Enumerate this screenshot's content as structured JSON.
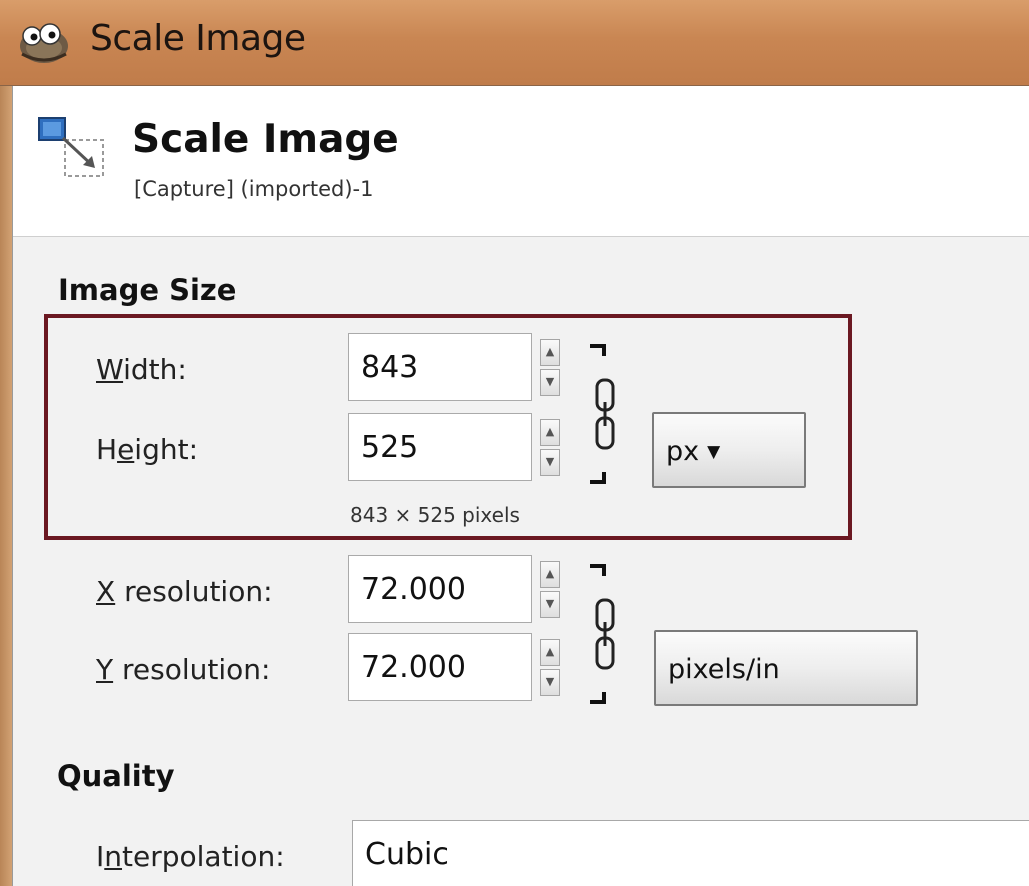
{
  "window": {
    "title": "Scale Image",
    "icon": "gimp-icon"
  },
  "header": {
    "title": "Scale Image",
    "subtitle": "[Capture] (imported)-1",
    "icon": "scale-image-icon"
  },
  "image_size": {
    "section_label": "Image Size",
    "width_label_pre": "",
    "width_label_ul": "W",
    "width_label_post": "idth:",
    "width_value": "843",
    "height_label_pre": "H",
    "height_label_ul": "e",
    "height_label_post": "ight:",
    "height_value": "525",
    "unit": "px",
    "pixel_note": "843 × 525 pixels"
  },
  "resolution": {
    "x_label_ul": "X",
    "x_label_post": " resolution:",
    "x_value": "72.000",
    "y_label_ul": "Y",
    "y_label_post": " resolution:",
    "y_value": "72.000",
    "unit": "pixels/in"
  },
  "quality": {
    "section_label": "Quality",
    "interp_label_pre": "I",
    "interp_label_ul": "n",
    "interp_label_post": "terpolation:",
    "interp_value": "Cubic"
  },
  "colors": {
    "titlebar": "#c98653",
    "highlight": "#6b1822",
    "dialog_bg": "#f2f2f2"
  }
}
